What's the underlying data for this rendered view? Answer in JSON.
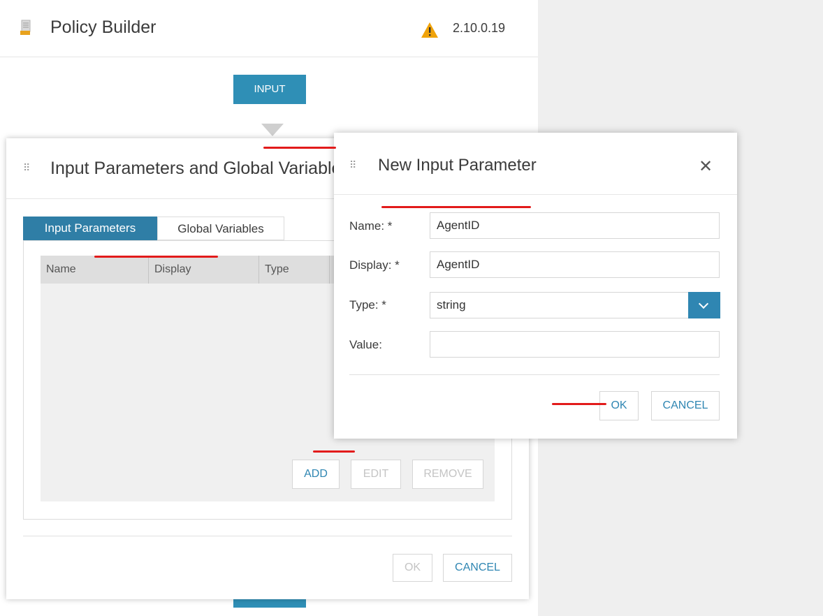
{
  "app": {
    "title": "Policy Builder",
    "version": "2.10.0.19",
    "icons": [
      "document-icon",
      "warning-icon"
    ]
  },
  "flow": {
    "input_node_label": "INPUT"
  },
  "params_dialog": {
    "title": "Input Parameters and Global Variables",
    "tabs": [
      {
        "label": "Input Parameters",
        "active": true
      },
      {
        "label": "Global Variables",
        "active": false
      }
    ],
    "columns": [
      "Name",
      "Display",
      "Type"
    ],
    "rows": [],
    "buttons": {
      "add": "ADD",
      "edit": "EDIT",
      "remove": "REMOVE"
    },
    "footer": {
      "ok": "OK",
      "cancel": "CANCEL"
    }
  },
  "new_param_dialog": {
    "title": "New Input Parameter",
    "fields": {
      "name": {
        "label": "Name: *",
        "value": "AgentID"
      },
      "display": {
        "label": "Display: *",
        "value": "AgentID"
      },
      "type": {
        "label": "Type: *",
        "value": "string"
      },
      "value": {
        "label": "Value:",
        "value": ""
      }
    },
    "buttons": {
      "ok": "OK",
      "cancel": "CANCEL"
    }
  },
  "colors": {
    "accent": "#2f86b2",
    "tab_active": "#2f7ea6",
    "annotation": "#e21b1b"
  }
}
